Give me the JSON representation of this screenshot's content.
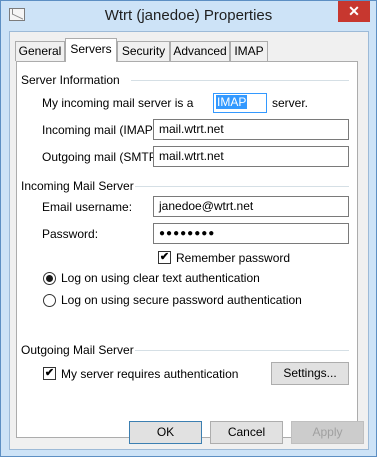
{
  "window": {
    "title": "Wtrt (janedoe) Properties",
    "close_glyph": "✕"
  },
  "tabs": [
    {
      "label": "General"
    },
    {
      "label": "Servers"
    },
    {
      "label": "Security"
    },
    {
      "label": "Advanced"
    },
    {
      "label": "IMAP"
    }
  ],
  "active_tab": "Servers",
  "server_info": {
    "heading": "Server Information",
    "incoming_type_prefix": "My incoming mail server is a",
    "incoming_type_value": "IMAP",
    "incoming_type_suffix": "server.",
    "incoming_label": "Incoming mail (IMAP):",
    "incoming_value": "mail.wtrt.net",
    "outgoing_label": "Outgoing mail (SMTP):",
    "outgoing_value": "mail.wtrt.net"
  },
  "incoming_server": {
    "heading": "Incoming Mail Server",
    "username_label": "Email username:",
    "username_value": "janedoe@wtrt.net",
    "password_label": "Password:",
    "password_value": "●●●●●●●●",
    "remember_label": "Remember password",
    "remember_checked": true,
    "auth_options": [
      {
        "label": "Log on using clear text authentication",
        "selected": true
      },
      {
        "label": "Log on using secure password authentication",
        "selected": false
      }
    ]
  },
  "outgoing_server": {
    "heading": "Outgoing Mail Server",
    "requires_auth_label": "My server requires authentication",
    "requires_auth_checked": true,
    "settings_label": "Settings..."
  },
  "buttons": {
    "ok": "OK",
    "cancel": "Cancel",
    "apply": "Apply"
  },
  "check_glyph": "✔",
  "colors": {
    "titlebar": "#cde3f7",
    "close": "#c7372f",
    "selection": "#3399ff"
  }
}
